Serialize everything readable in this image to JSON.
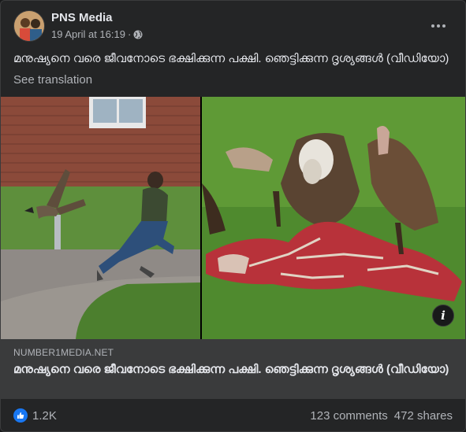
{
  "post": {
    "author": "PNS Media",
    "date": "19 April at 16:19",
    "separator": "·",
    "privacy_icon": "globe-icon",
    "more_icon": "more-options-icon",
    "caption": "മനുഷ്യനെ വരെ ജീവനോടെ ഭക്ഷിക്കുന്ന പക്ഷി. ഞെട്ടിക്കുന്ന ദൃശ്യങ്ങൾ (വീഡിയോ)",
    "see_translation": "See translation"
  },
  "link": {
    "domain": "NUMBER1MEDIA.NET",
    "title": "മനുഷ്യനെ വരെ ജീവനോടെ ഭക്ഷിക്കുന്ന പക്ഷി. ഞെട്ടിക്കുന്ന ദൃശ്യങ്ങൾ (വീഡിയോ)",
    "info_label": "i"
  },
  "footer": {
    "reaction_icon": "like-icon",
    "reaction_count": "1.2K",
    "comments": "123 comments",
    "shares": "472 shares"
  },
  "colors": {
    "background": "#242526",
    "card": "#3a3b3c",
    "primary_text": "#e4e6eb",
    "secondary_text": "#b0b3b8",
    "like_blue": "#1877f2"
  }
}
